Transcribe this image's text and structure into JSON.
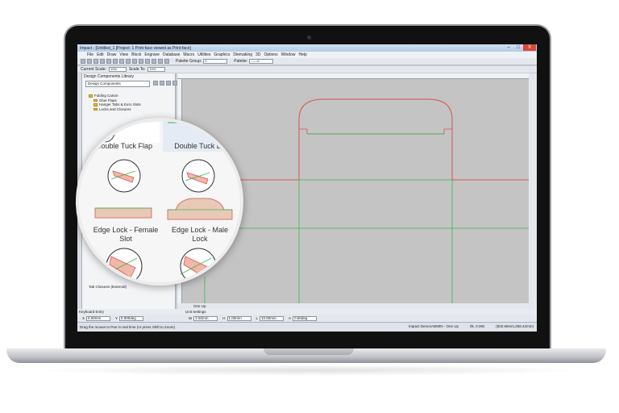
{
  "window": {
    "title": "Impact - [Untitled_1 [Project: 1 Print-face viewed as Print-face]",
    "controls": {
      "minimize": "–",
      "maximize": "□",
      "close": "X"
    }
  },
  "menu": [
    "File",
    "Edit",
    "Draw",
    "View",
    "Block",
    "Engrave",
    "Database",
    "Macro",
    "Utilities",
    "Graphics",
    "Diemaking",
    "3D",
    "Options",
    "Window",
    "Help"
  ],
  "toolbar": {
    "palette_group_label": "Palette Group:",
    "palette_group_value": "0",
    "palette_label": "Palette:",
    "palette_value": "------0"
  },
  "scalebar": {
    "current_scale_label": "Current Scale:",
    "current_scale_value": "10%",
    "scale_to_label": "Scale To:",
    "scale_to_value": "10%"
  },
  "panel": {
    "title": "Design Components Library",
    "combo_value": "Design Components",
    "tree": [
      "Folding Carton",
      "Glue Flaps",
      "Hanger Tabs & Euro Slots",
      "Locks and Closures"
    ],
    "bottom_item": "Tab Closures (External)"
  },
  "magnifier": {
    "labels": {
      "double_tuck_flap": "Double Tuck Flap",
      "double_tuck_lock": "Double Tuck Lock",
      "edge_lock_female_line1": "Edge Lock - Female",
      "edge_lock_female_line2": "Slot",
      "edge_lock_male_line1": "Edge Lock - Male",
      "edge_lock_male_line2": "Lock"
    }
  },
  "layer": {
    "tab": "One Up"
  },
  "keyboard_entry": "Keyboard Entry",
  "unit_settings": "Unit Settings",
  "fields": [
    {
      "label": "X",
      "value": "0.00mm"
    },
    {
      "label": "Y",
      "value": "0.000deg"
    },
    {
      "label": "W",
      "value": "2.50mm"
    },
    {
      "label": "H",
      "value": "1.00mm"
    },
    {
      "label": "L",
      "value": "10.00mm"
    },
    {
      "label": "A",
      "value": "0.50deg"
    }
  ],
  "status": {
    "hint": "Drag the mouse to Pan in real time (or press Shift to Zoom)",
    "user": "Impact Demo\\ADMIN - One Up",
    "info": "0k, 0.00s",
    "coords": "(502.69mm,258.42mm)"
  },
  "colors": {
    "cut_line": "#d9534f",
    "crease_line": "#3cb44b",
    "canvas": "#c4c4c4"
  }
}
